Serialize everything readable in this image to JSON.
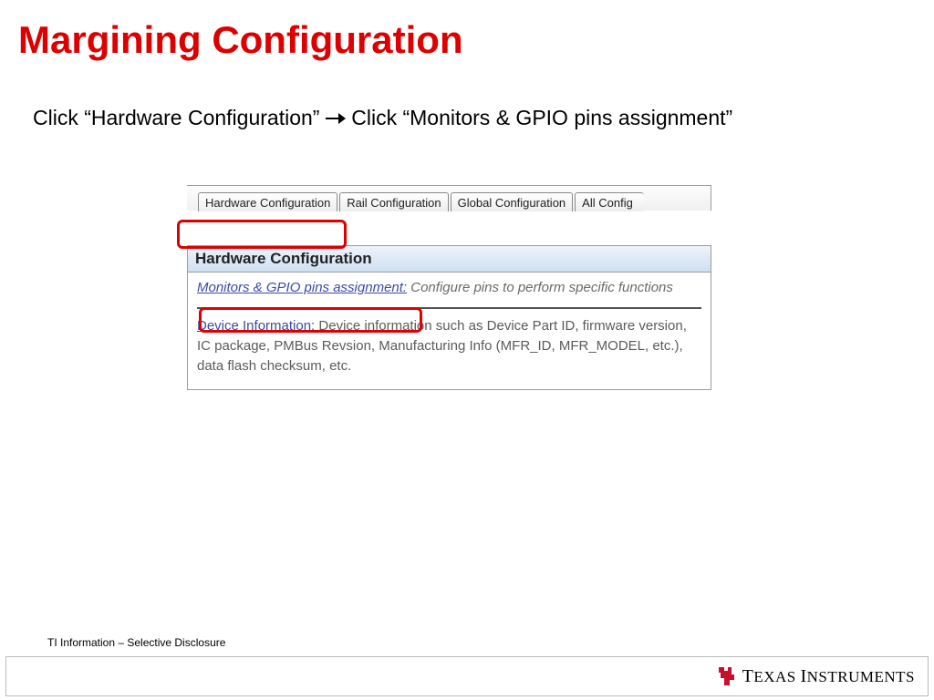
{
  "title": "Margining Configuration",
  "instruction": {
    "part1": "Click “Hardware Configuration” ",
    "arrow": "→",
    "part2": " Click “Monitors & GPIO pins assignment”"
  },
  "tabs": [
    "Hardware Configuration",
    "Rail Configuration",
    "Global Configuration",
    "All Config"
  ],
  "panel": {
    "title": "Hardware Configuration",
    "link1": "Monitors & GPIO pins assignment:",
    "desc1": " Configure pins to perform specific functions",
    "link2": "Device Information:",
    "desc2": " Device information such as Device Part ID, firmware version, IC package, PMBus Revsion, Manufacturing Info (MFR_ID, MFR_MODEL, etc.), data flash checksum, etc."
  },
  "footer": {
    "info": "TI Information – Selective Disclosure",
    "brand_prefix": "T",
    "brand_exas": "EXAS ",
    "brand_i": "I",
    "brand_nstruments": "NSTRUMENTS"
  },
  "colors": {
    "accent_red": "#dc0000",
    "link_blue": "#3a4aa8"
  }
}
